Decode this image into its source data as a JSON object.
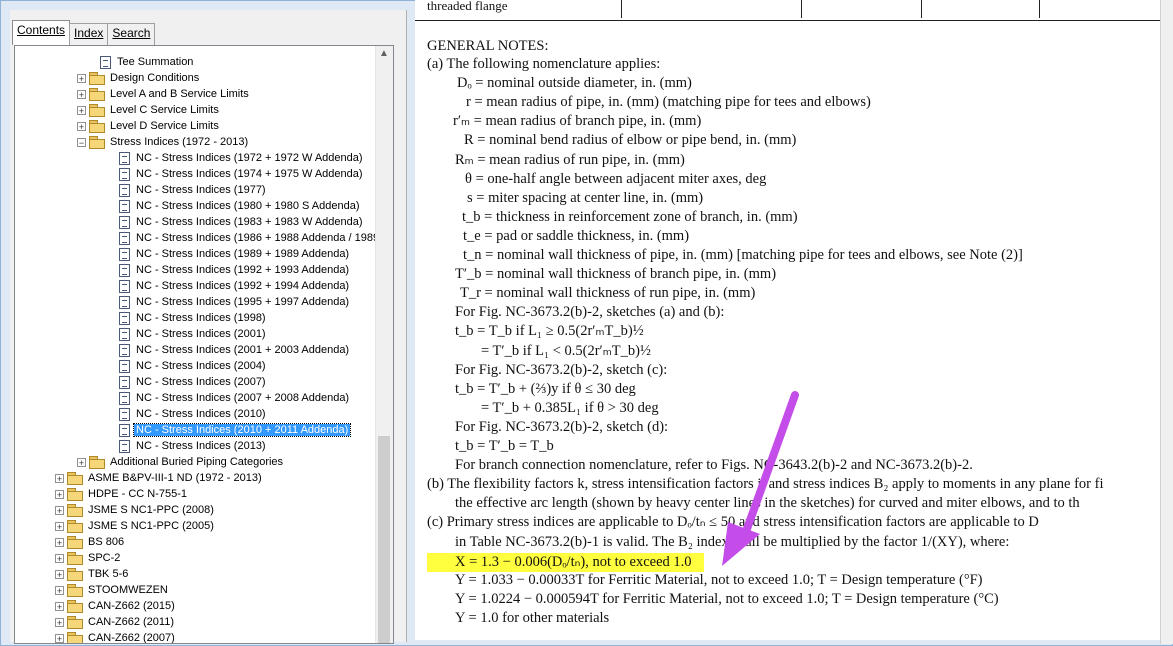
{
  "tabs": [
    {
      "label": "Contents"
    },
    {
      "label": "Index"
    },
    {
      "label": "Search"
    }
  ],
  "tree": [
    {
      "label": "Tee Summation",
      "type": "doc",
      "indent": 4
    },
    {
      "label": "Design Conditions",
      "type": "folder",
      "indent": 3
    },
    {
      "label": "Level A and B Service Limits",
      "type": "folder",
      "indent": 3
    },
    {
      "label": "Level C Service Limits",
      "type": "folder",
      "indent": 3
    },
    {
      "label": "Level D Service Limits",
      "type": "folder",
      "indent": 3
    },
    {
      "label": "Stress Indices (1972 - 2013)",
      "type": "folder-open",
      "indent": 3
    },
    {
      "label": "NC - Stress Indices (1972 + 1972 W Addenda)",
      "type": "doc",
      "indent": 5
    },
    {
      "label": "NC - Stress Indices (1974 + 1975 W Addenda)",
      "type": "doc",
      "indent": 5
    },
    {
      "label": "NC - Stress Indices (1977)",
      "type": "doc",
      "indent": 5
    },
    {
      "label": "NC - Stress Indices (1980 + 1980 S Addenda)",
      "type": "doc",
      "indent": 5
    },
    {
      "label": "NC - Stress Indices (1983 + 1983 W Addenda)",
      "type": "doc",
      "indent": 5
    },
    {
      "label": "NC - Stress Indices (1986 + 1988 Addenda / 1989",
      "type": "doc",
      "indent": 5
    },
    {
      "label": "NC - Stress Indices (1989 + 1989 Addenda)",
      "type": "doc",
      "indent": 5
    },
    {
      "label": "NC - Stress Indices (1992 + 1993 Addenda)",
      "type": "doc",
      "indent": 5
    },
    {
      "label": "NC - Stress Indices (1992 + 1994 Addenda)",
      "type": "doc",
      "indent": 5
    },
    {
      "label": "NC - Stress Indices (1995 + 1997 Addenda)",
      "type": "doc",
      "indent": 5
    },
    {
      "label": "NC - Stress Indices (1998)",
      "type": "doc",
      "indent": 5
    },
    {
      "label": "NC - Stress Indices (2001)",
      "type": "doc",
      "indent": 5
    },
    {
      "label": "NC - Stress Indices (2001 + 2003 Addenda)",
      "type": "doc",
      "indent": 5
    },
    {
      "label": "NC - Stress Indices (2004)",
      "type": "doc",
      "indent": 5
    },
    {
      "label": "NC - Stress Indices (2007)",
      "type": "doc",
      "indent": 5
    },
    {
      "label": "NC - Stress Indices (2007 + 2008 Addenda)",
      "type": "doc",
      "indent": 5
    },
    {
      "label": "NC - Stress Indices (2010)",
      "type": "doc",
      "indent": 5
    },
    {
      "label": "NC - Stress Indices (2010 + 2011 Addenda)",
      "type": "doc",
      "indent": 5,
      "selected": true
    },
    {
      "label": "NC - Stress Indices (2013)",
      "type": "doc",
      "indent": 5
    },
    {
      "label": "Additional Buried Piping Categories",
      "type": "folder",
      "indent": 3
    },
    {
      "label": "ASME B&PV-III-1 ND (1972 - 2013)",
      "type": "folder",
      "indent": 2
    },
    {
      "label": "HDPE - CC N-755-1",
      "type": "folder",
      "indent": 2
    },
    {
      "label": "JSME S NC1-PPC (2008)",
      "type": "folder",
      "indent": 2
    },
    {
      "label": "JSME S NC1-PPC (2005)",
      "type": "folder",
      "indent": 2
    },
    {
      "label": "BS 806",
      "type": "folder",
      "indent": 2
    },
    {
      "label": "SPC-2",
      "type": "folder",
      "indent": 2
    },
    {
      "label": "TBK 5-6",
      "type": "folder",
      "indent": 2
    },
    {
      "label": "STOOMWEZEN",
      "type": "folder",
      "indent": 2
    },
    {
      "label": "CAN-Z662 (2015)",
      "type": "folder",
      "indent": 2
    },
    {
      "label": "CAN-Z662 (2011)",
      "type": "folder",
      "indent": 2
    },
    {
      "label": "CAN-Z662 (2007)",
      "type": "folder",
      "indent": 2
    }
  ],
  "document": {
    "top_cell": "threaded flange",
    "heading": "GENERAL NOTES:",
    "lines": [
      {
        "t": "(a)  The following nomenclature applies:",
        "x": 12
      },
      {
        "t": "Dₒ = nominal outside diameter, in. (mm)",
        "x": 42
      },
      {
        "t": "r = mean radius of pipe, in. (mm) (matching pipe for tees and elbows)",
        "x": 51
      },
      {
        "t": "r′ₘ = mean radius of branch pipe, in. (mm)",
        "x": 38
      },
      {
        "t": "R = nominal bend radius of elbow or pipe bend, in. (mm)",
        "x": 49
      },
      {
        "t": "Rₘ = mean radius of run pipe, in. (mm)",
        "x": 40
      },
      {
        "t": "θ = one-half angle between adjacent miter axes, deg",
        "x": 50
      },
      {
        "t": "s = miter spacing at center line, in. (mm)",
        "x": 52
      },
      {
        "t": "t_b = thickness in reinforcement zone of branch, in. (mm)",
        "x": 47
      },
      {
        "t": "t_e = pad or saddle thickness, in. (mm)",
        "x": 48
      },
      {
        "t": "t_n = nominal wall thickness of pipe, in. (mm) [matching pipe for tees and elbows, see Note (2)]",
        "x": 48
      },
      {
        "t": "T′_b = nominal wall thickness of branch pipe, in. (mm)",
        "x": 40
      },
      {
        "t": "T_r = nominal wall thickness of run pipe, in. (mm)",
        "x": 45
      },
      {
        "t": "For Fig. NC-3673.2(b)-2, sketches (a) and (b):",
        "x": 40
      },
      {
        "t": "t_b = T_b if L₁ ≥ 0.5(2r′ₘT_b)½",
        "x": 40
      },
      {
        "t": "= T′_b  if L₁ < 0.5(2r′ₘT_b)½",
        "x": 66
      },
      {
        "t": "For Fig. NC-3673.2(b)-2, sketch (c):",
        "x": 40
      },
      {
        "t": "t_b = T′_b + (⅔)y if θ ≤ 30 deg",
        "x": 40
      },
      {
        "t": "= T′_b + 0.385L₁ if θ > 30 deg",
        "x": 66
      },
      {
        "t": "For Fig. NC-3673.2(b)-2, sketch (d):",
        "x": 40
      },
      {
        "t": "t_b = T′_b = T_b",
        "x": 40
      },
      {
        "t": "For branch connection nomenclature, refer to Figs. NC-3643.2(b)-2 and NC-3673.2(b)-2.",
        "x": 40
      },
      {
        "t": "(b)  The flexibility factors k, stress intensification factors i, and stress indices B₂ apply to moments in any plane for fi",
        "x": 12
      },
      {
        "t": "the effective arc length (shown by heavy center lines in the sketches) for curved and miter elbows, and to th",
        "x": 40
      },
      {
        "t": "(c)  Primary stress indices are applicable to Dₒ/tₙ ≤ 50 and stress intensification factors are applicable to D",
        "x": 12
      },
      {
        "t": "in Table NC-3673.2(b)-1 is valid. The B₂ index shall be multiplied by the factor 1/(XY), where:",
        "x": 40
      },
      {
        "t": "X = 1.3 − 0.006(Dₒ/tₙ), not to exceed 1.0",
        "x": 40,
        "highlight": true
      },
      {
        "t": "Y = 1.033 − 0.00033T for Ferritic Material, not to exceed 1.0; T = Design temperature (°F)",
        "x": 40
      },
      {
        "t": "Y = 1.0224 − 0.000594T for Ferritic Material, not to exceed 1.0; T = Design temperature (°C)",
        "x": 40
      },
      {
        "t": "Y = 1.0 for other materials",
        "x": 40
      }
    ]
  },
  "colors": {
    "highlight": "#ffff40",
    "arrow": "#c44dea",
    "selection": "#3399ff"
  }
}
